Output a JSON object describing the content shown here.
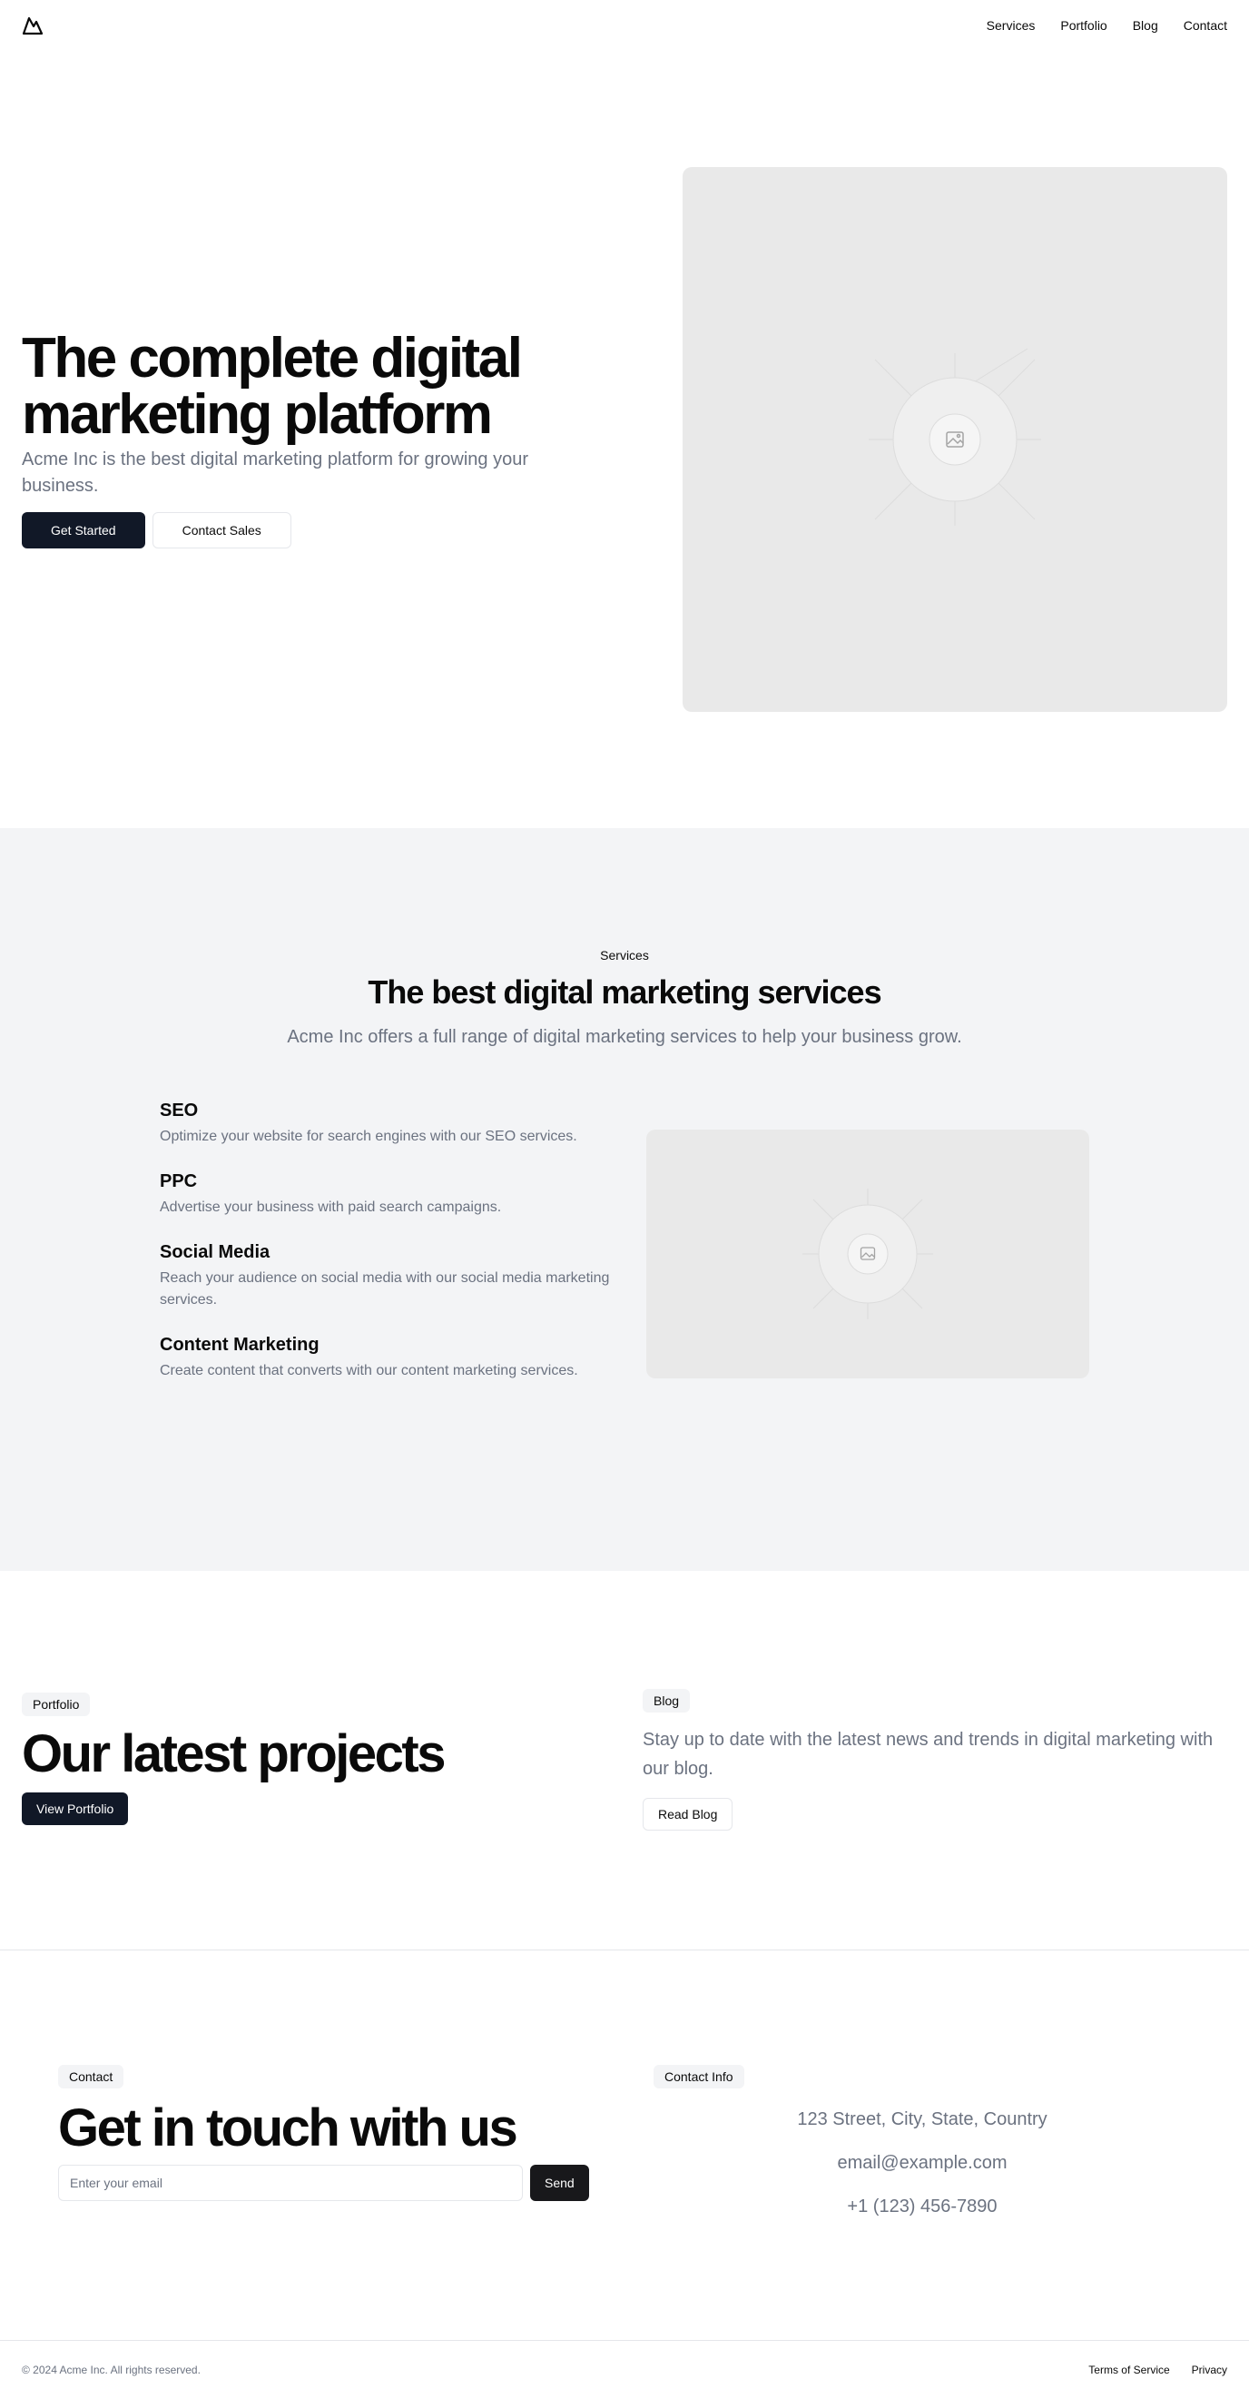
{
  "header": {
    "logo_icon": "mountain-icon",
    "nav": [
      "Services",
      "Portfolio",
      "Blog",
      "Contact"
    ]
  },
  "hero": {
    "title_line1": "The complete digital",
    "title_line2": "marketing platform",
    "subtitle": "Acme Inc is the best digital marketing platform for growing your business.",
    "primary_button": "Get Started",
    "secondary_button": "Contact Sales",
    "image_icon": "image-placeholder-icon"
  },
  "services": {
    "tag": "Services",
    "title": "The best digital marketing services",
    "subtitle": "Acme Inc offers a full range of digital marketing services to help your business grow.",
    "items": [
      {
        "name": "SEO",
        "desc": "Optimize your website for search engines with our SEO services."
      },
      {
        "name": "PPC",
        "desc": "Advertise your business with paid search campaigns."
      },
      {
        "name": "Social Media",
        "desc": "Reach your audience on social media with our social media marketing services."
      },
      {
        "name": "Content Marketing",
        "desc": "Create content that converts with our content marketing services."
      }
    ]
  },
  "portfolio": {
    "badge": "Portfolio",
    "title": "Our latest projects",
    "button": "View Portfolio"
  },
  "blog": {
    "badge": "Blog",
    "subtitle": "Stay up to date with the latest news and trends in digital marketing with our blog.",
    "button": "Read Blog"
  },
  "contact": {
    "badge": "Contact",
    "title": "Get in touch with us",
    "email_placeholder": "Enter your email",
    "send_button": "Send",
    "info_badge": "Contact Info",
    "address": "123 Street, City, State, Country",
    "email": "email@example.com",
    "phone": "+1 (123) 456-7890"
  },
  "footer": {
    "copyright": "© 2024 Acme Inc. All rights reserved.",
    "links": [
      "Terms of Service",
      "Privacy"
    ]
  },
  "colors": {
    "primary_button": "#111827",
    "muted_text": "#6b7280",
    "section_bg": "#f3f4f6",
    "placeholder_bg": "#e9e9e9"
  }
}
